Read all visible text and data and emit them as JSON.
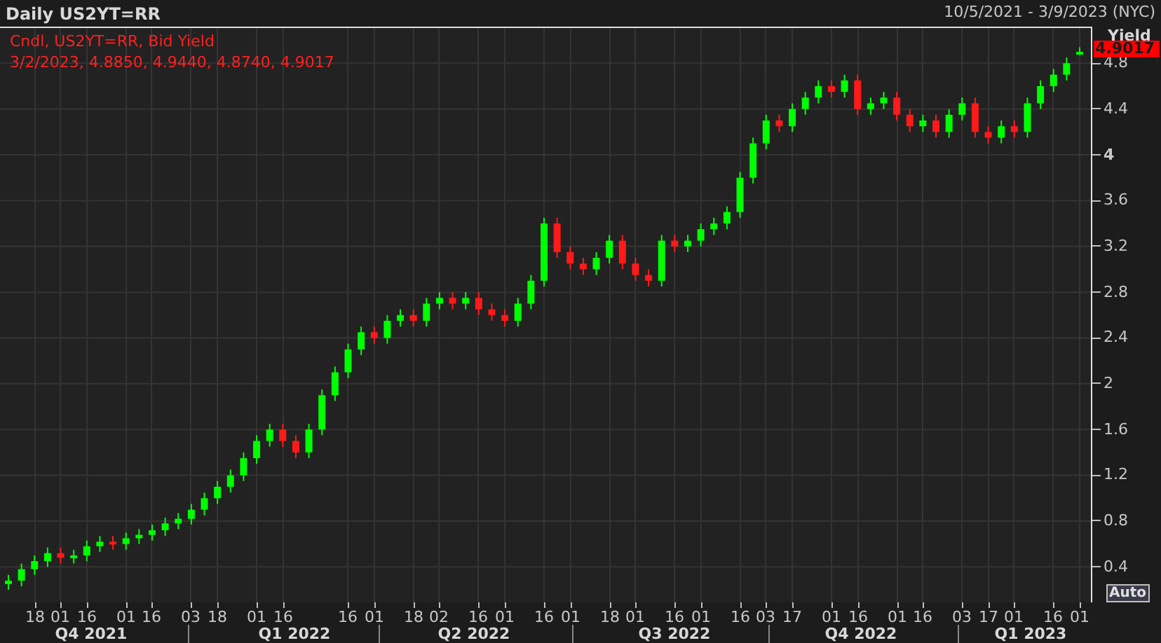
{
  "header": {
    "title": "Daily US2YT=RR",
    "range": "10/5/2021 - 3/9/2023 (NYC)"
  },
  "legend": {
    "line_1": "Cndl, US2YT=RR, Bid Yield",
    "line_2": "3/2/2023, 4.8850, 4.9440, 4.8740, 4.9017"
  },
  "axis": {
    "last_value": "4.9017",
    "auto_button": "Auto"
  },
  "chart_data": {
    "type": "candlestick",
    "ylabel": "Yield",
    "ylim": [
      0.09,
      5.12
    ],
    "grid": true,
    "categories": [
      null,
      null,
      "18",
      null,
      "01",
      null,
      "16",
      null,
      null,
      "01",
      null,
      "16",
      null,
      null,
      "03",
      null,
      "18",
      null,
      null,
      "01",
      null,
      "16",
      null,
      null,
      null,
      null,
      "16",
      null,
      "01",
      null,
      null,
      "18",
      null,
      "02",
      null,
      null,
      "16",
      null,
      "01",
      null,
      null,
      "16",
      null,
      "01",
      null,
      null,
      "18",
      null,
      "01",
      null,
      null,
      "16",
      null,
      "01",
      null,
      null,
      "16",
      null,
      "03",
      null,
      "17",
      null,
      null,
      "01",
      null,
      "16",
      null,
      null,
      "01",
      null,
      "16",
      null,
      null,
      "03",
      null,
      "17",
      null,
      "01",
      null,
      null,
      "16",
      null,
      "01"
    ],
    "yticks": [
      0.4,
      0.8,
      1.2,
      1.6,
      2,
      2.4,
      2.8,
      3.2,
      3.6,
      4,
      4.4,
      4.8
    ],
    "ohlc": [
      [
        0.25,
        0.33,
        0.2,
        0.28
      ],
      [
        0.28,
        0.43,
        0.23,
        0.38
      ],
      [
        0.38,
        0.5,
        0.33,
        0.45
      ],
      [
        0.45,
        0.57,
        0.4,
        0.52
      ],
      [
        0.52,
        0.57,
        0.43,
        0.48
      ],
      [
        0.48,
        0.55,
        0.43,
        0.5
      ],
      [
        0.5,
        0.63,
        0.45,
        0.58
      ],
      [
        0.58,
        0.67,
        0.53,
        0.62
      ],
      [
        0.62,
        0.67,
        0.55,
        0.6
      ],
      [
        0.6,
        0.7,
        0.55,
        0.65
      ],
      [
        0.65,
        0.73,
        0.6,
        0.68
      ],
      [
        0.68,
        0.77,
        0.63,
        0.72
      ],
      [
        0.72,
        0.83,
        0.67,
        0.78
      ],
      [
        0.78,
        0.87,
        0.73,
        0.82
      ],
      [
        0.82,
        0.95,
        0.77,
        0.9
      ],
      [
        0.9,
        1.05,
        0.85,
        1.0
      ],
      [
        1.0,
        1.15,
        0.95,
        1.1
      ],
      [
        1.1,
        1.25,
        1.05,
        1.2
      ],
      [
        1.2,
        1.4,
        1.15,
        1.35
      ],
      [
        1.35,
        1.55,
        1.3,
        1.5
      ],
      [
        1.5,
        1.65,
        1.45,
        1.6
      ],
      [
        1.6,
        1.65,
        1.45,
        1.5
      ],
      [
        1.5,
        1.55,
        1.35,
        1.4
      ],
      [
        1.4,
        1.65,
        1.35,
        1.6
      ],
      [
        1.6,
        1.95,
        1.55,
        1.9
      ],
      [
        1.9,
        2.15,
        1.85,
        2.1
      ],
      [
        2.1,
        2.35,
        2.05,
        2.3
      ],
      [
        2.3,
        2.5,
        2.25,
        2.45
      ],
      [
        2.45,
        2.5,
        2.35,
        2.4
      ],
      [
        2.4,
        2.6,
        2.35,
        2.55
      ],
      [
        2.55,
        2.65,
        2.5,
        2.6
      ],
      [
        2.6,
        2.65,
        2.5,
        2.55
      ],
      [
        2.55,
        2.75,
        2.5,
        2.7
      ],
      [
        2.7,
        2.8,
        2.65,
        2.75
      ],
      [
        2.75,
        2.8,
        2.65,
        2.7
      ],
      [
        2.7,
        2.8,
        2.65,
        2.75
      ],
      [
        2.75,
        2.8,
        2.6,
        2.65
      ],
      [
        2.65,
        2.7,
        2.55,
        2.6
      ],
      [
        2.6,
        2.65,
        2.5,
        2.55
      ],
      [
        2.55,
        2.75,
        2.5,
        2.7
      ],
      [
        2.7,
        2.95,
        2.65,
        2.9
      ],
      [
        2.9,
        3.45,
        2.85,
        3.4
      ],
      [
        3.4,
        3.45,
        3.1,
        3.15
      ],
      [
        3.15,
        3.2,
        3.0,
        3.05
      ],
      [
        3.05,
        3.1,
        2.95,
        3.0
      ],
      [
        3.0,
        3.15,
        2.95,
        3.1
      ],
      [
        3.1,
        3.3,
        3.05,
        3.25
      ],
      [
        3.25,
        3.3,
        3.0,
        3.05
      ],
      [
        3.05,
        3.1,
        2.9,
        2.95
      ],
      [
        2.95,
        3.0,
        2.85,
        2.9
      ],
      [
        2.9,
        3.3,
        2.85,
        3.25
      ],
      [
        3.25,
        3.3,
        3.15,
        3.2
      ],
      [
        3.2,
        3.3,
        3.15,
        3.25
      ],
      [
        3.25,
        3.4,
        3.2,
        3.35
      ],
      [
        3.35,
        3.45,
        3.3,
        3.4
      ],
      [
        3.4,
        3.55,
        3.35,
        3.5
      ],
      [
        3.5,
        3.85,
        3.45,
        3.8
      ],
      [
        3.8,
        4.15,
        3.75,
        4.1
      ],
      [
        4.1,
        4.35,
        4.05,
        4.3
      ],
      [
        4.3,
        4.35,
        4.2,
        4.25
      ],
      [
        4.25,
        4.45,
        4.2,
        4.4
      ],
      [
        4.4,
        4.55,
        4.35,
        4.5
      ],
      [
        4.5,
        4.65,
        4.45,
        4.6
      ],
      [
        4.6,
        4.65,
        4.5,
        4.55
      ],
      [
        4.55,
        4.7,
        4.5,
        4.65
      ],
      [
        4.65,
        4.7,
        4.35,
        4.4
      ],
      [
        4.4,
        4.5,
        4.35,
        4.45
      ],
      [
        4.45,
        4.55,
        4.4,
        4.5
      ],
      [
        4.5,
        4.55,
        4.3,
        4.35
      ],
      [
        4.35,
        4.4,
        4.2,
        4.25
      ],
      [
        4.25,
        4.35,
        4.2,
        4.3
      ],
      [
        4.3,
        4.35,
        4.15,
        4.2
      ],
      [
        4.2,
        4.4,
        4.15,
        4.35
      ],
      [
        4.35,
        4.5,
        4.3,
        4.45
      ],
      [
        4.45,
        4.5,
        4.15,
        4.2
      ],
      [
        4.2,
        4.25,
        4.1,
        4.15
      ],
      [
        4.15,
        4.3,
        4.1,
        4.25
      ],
      [
        4.25,
        4.3,
        4.15,
        4.2
      ],
      [
        4.2,
        4.5,
        4.15,
        4.45
      ],
      [
        4.45,
        4.65,
        4.4,
        4.6
      ],
      [
        4.6,
        4.75,
        4.55,
        4.7
      ],
      [
        4.7,
        4.85,
        4.65,
        4.8
      ],
      [
        4.89,
        4.94,
        4.87,
        4.9
      ]
    ]
  },
  "time_axis": {
    "quarters": [
      "Q4 2021",
      "Q1 2022",
      "Q2 2022",
      "Q3 2022",
      "Q4 2022",
      "Q1 2023"
    ]
  }
}
